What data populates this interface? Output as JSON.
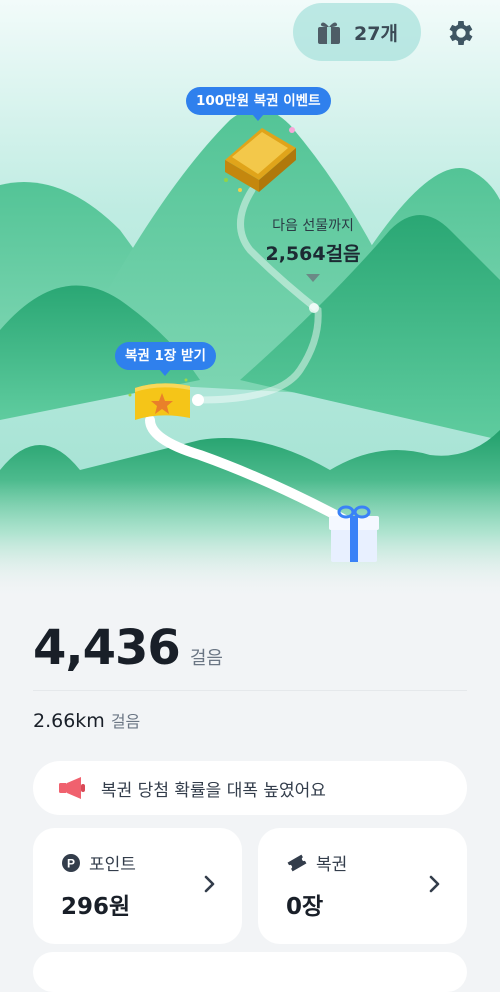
{
  "header": {
    "gift_count": "27개"
  },
  "map": {
    "event_label": "100만원 복권 이벤트",
    "ticket_label": "복권 1장 받기",
    "next_gift_label": "다음 선물까지",
    "next_gift_steps": "2,564걸음"
  },
  "stats": {
    "steps_value": "4,436",
    "steps_unit": "걸음",
    "distance_value": "2.66km",
    "distance_unit": "걸음"
  },
  "banner": {
    "text": "복권 당첨 확률을 대폭 높였어요"
  },
  "cards": {
    "points": {
      "title": "포인트",
      "value": "296원"
    },
    "lottery": {
      "title": "복권",
      "value": "0장"
    }
  },
  "colors": {
    "accent": "#2f80ed",
    "mountain": "#2fb57f",
    "gift_box": "#e8f0ff",
    "ribbon": "#3a82f7",
    "ticket": "#f5c518"
  }
}
